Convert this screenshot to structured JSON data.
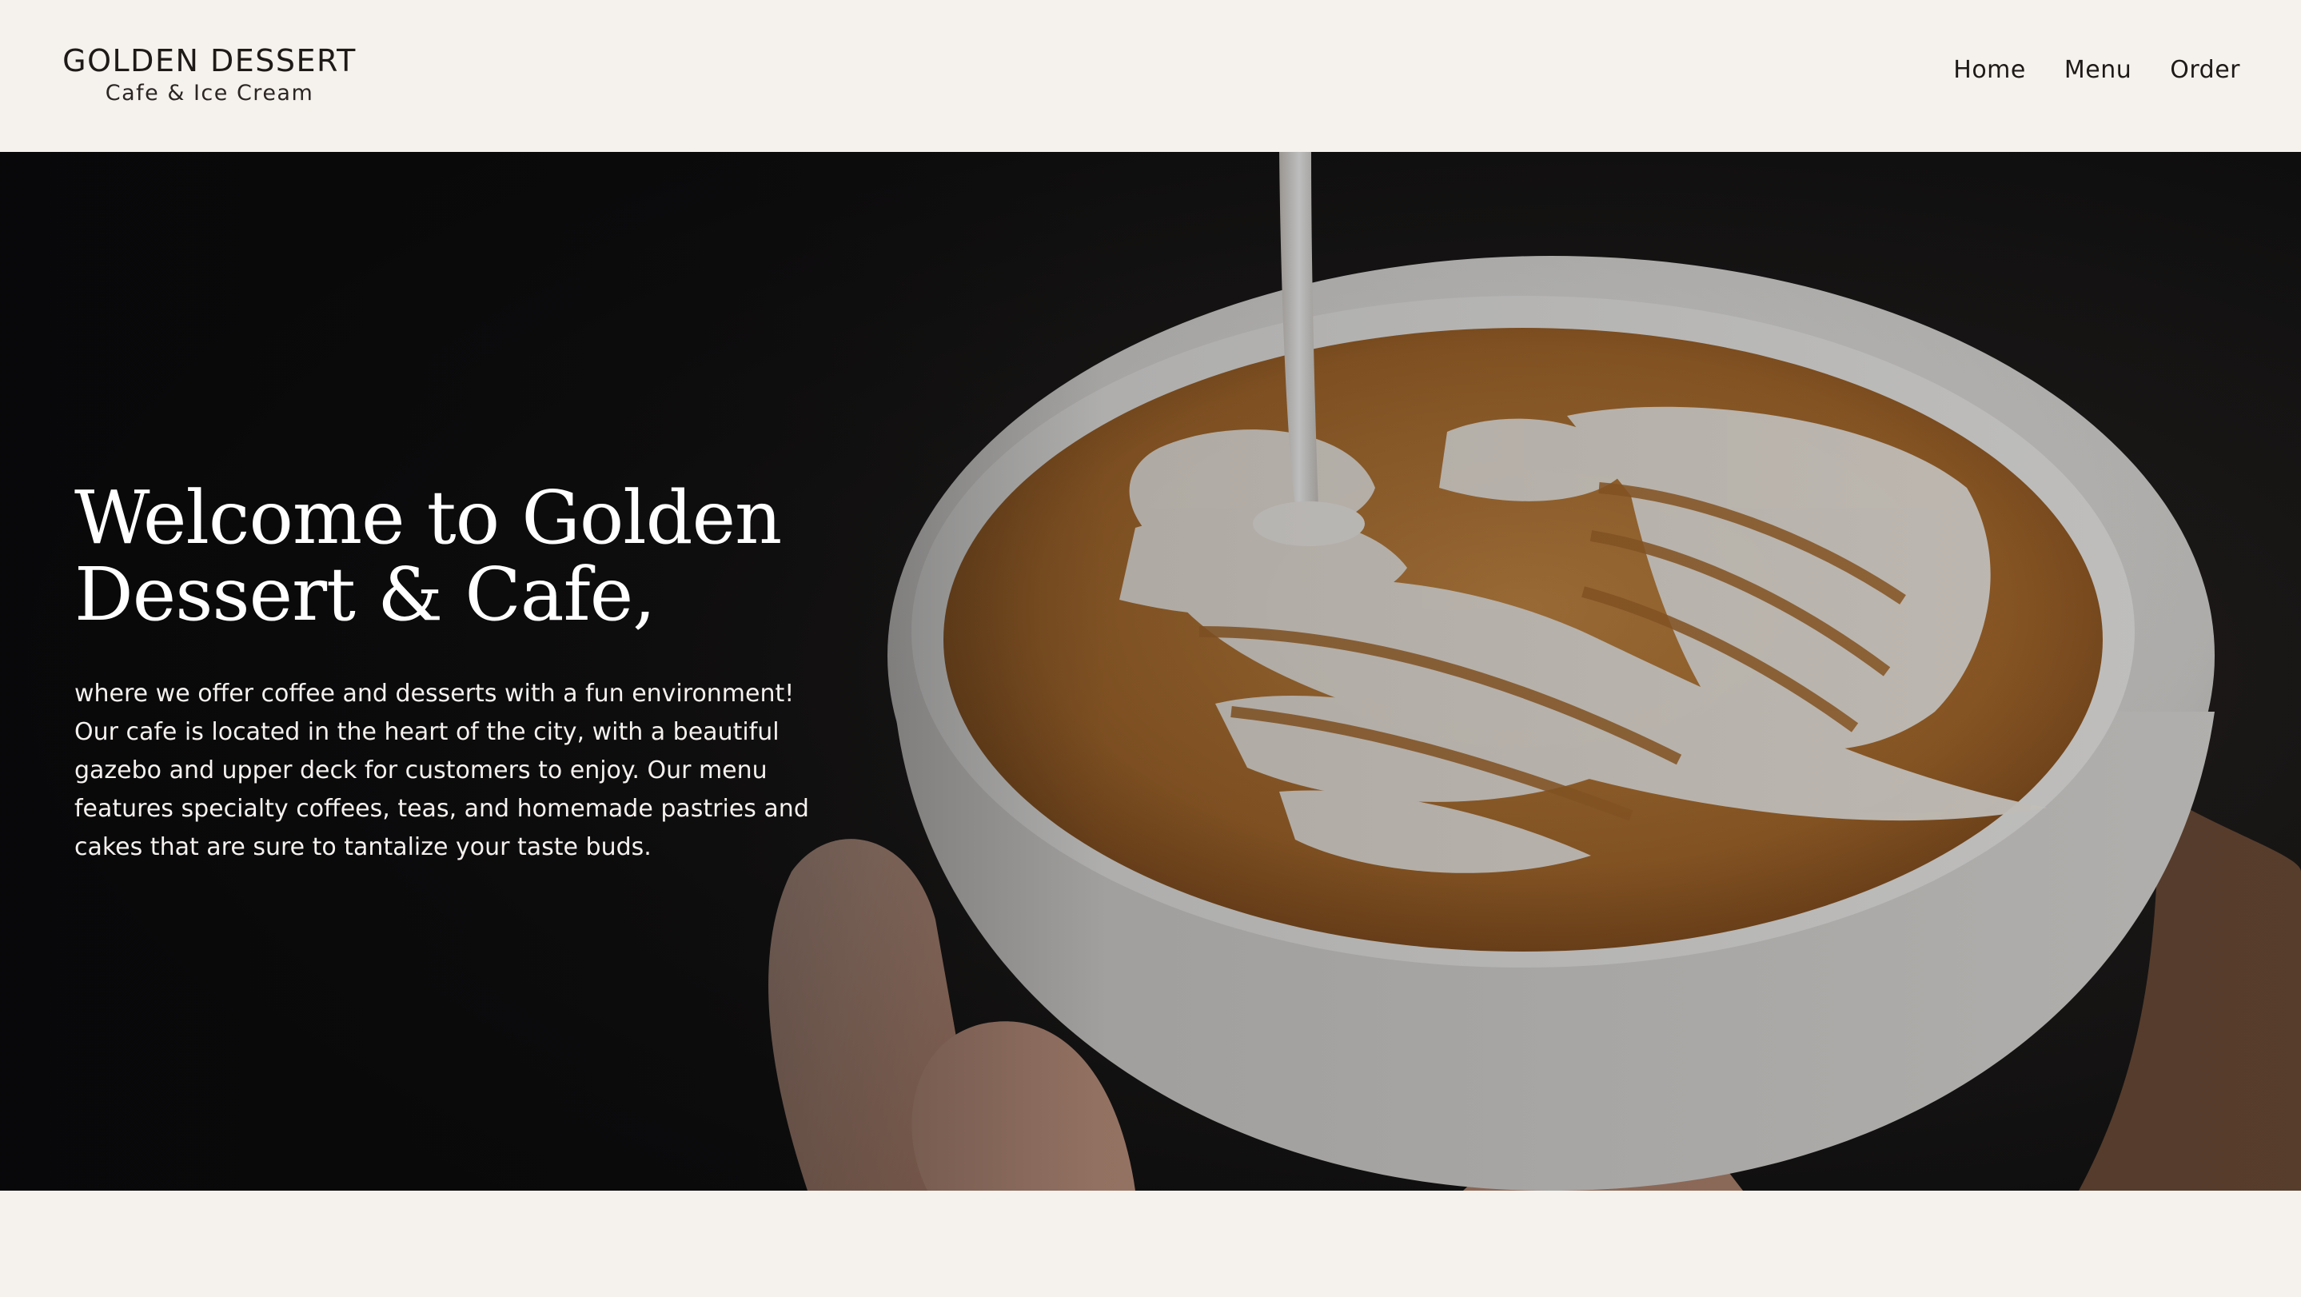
{
  "brand": {
    "title": "GOLDEN DESSERT",
    "subtitle": "Cafe & Ice Cream"
  },
  "nav": {
    "items": [
      {
        "label": "Home"
      },
      {
        "label": "Menu"
      },
      {
        "label": "Order"
      }
    ]
  },
  "hero": {
    "title": "Welcome to Golden Dessert & Cafe,",
    "body": "where we offer coffee and desserts with a fun environment! Our cafe is located in the heart of the city, with a beautiful gazebo and upper deck for customers to enjoy. Our menu features specialty coffees, teas, and homemade pastries and cakes that are sure to tantalize your taste buds.",
    "image_description": "latte-art-cup-image"
  },
  "colors": {
    "background": "#f5f1ed",
    "text_dark": "#1e1a18",
    "hero_bg": "#0d0d0e",
    "crema": "#a86a2a",
    "cup": "#e6e4e1"
  }
}
